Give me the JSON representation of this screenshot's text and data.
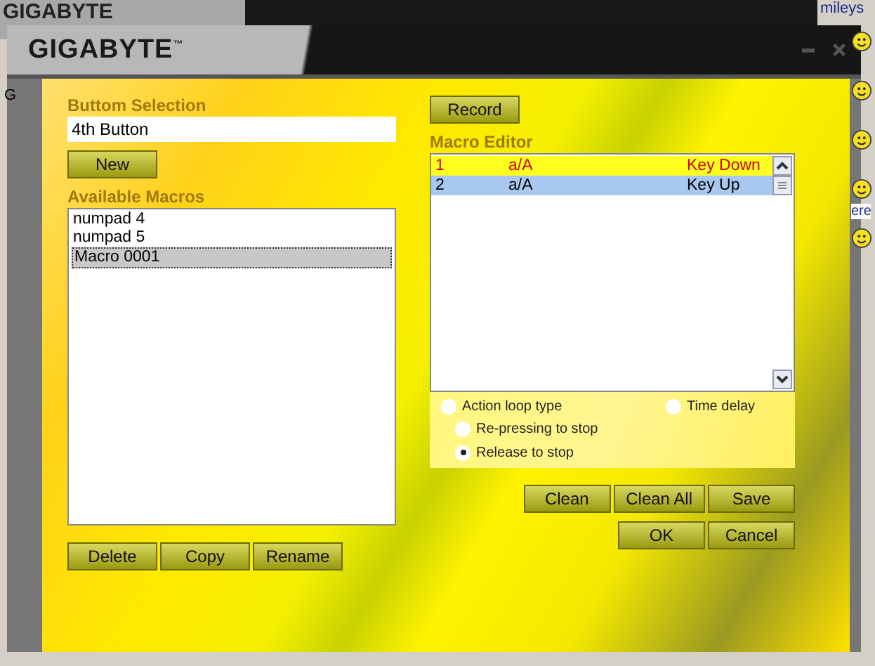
{
  "background_window": {
    "title": "GIGABYTE"
  },
  "background_texts": {
    "left": "G",
    "right_top": "mileys",
    "right_bottom": "ere"
  },
  "window": {
    "title": "GIGABYTE",
    "trademark": "™"
  },
  "button_selection": {
    "label": "Buttom Selection",
    "value": "4th Button"
  },
  "new_button": "New",
  "available_macros": {
    "label": "Available Macros",
    "items": [
      {
        "name": "numpad 4",
        "selected": false
      },
      {
        "name": "numpad 5",
        "selected": false
      },
      {
        "name": "Macro 0001",
        "selected": true
      }
    ]
  },
  "left_buttons": [
    "Delete",
    "Copy",
    "Rename"
  ],
  "record_button": "Record",
  "macro_editor": {
    "label": "Macro Editor",
    "rows": [
      {
        "number": "1",
        "key": "a/A",
        "action": "Key Down",
        "highlighted": true,
        "selected": false
      },
      {
        "number": "2",
        "key": "a/A",
        "action": "Key Up",
        "highlighted": false,
        "selected": true
      }
    ]
  },
  "options": [
    {
      "label": "Action loop type",
      "selected": false
    },
    {
      "label": "Time delay",
      "selected": false
    },
    {
      "label": "Re-pressing to stop",
      "selected": false
    },
    {
      "label": "Release to stop",
      "selected": true
    }
  ],
  "editor_buttons": [
    "Clean",
    "Clean All",
    "Save"
  ],
  "dialog_buttons": [
    "OK",
    "Cancel"
  ]
}
